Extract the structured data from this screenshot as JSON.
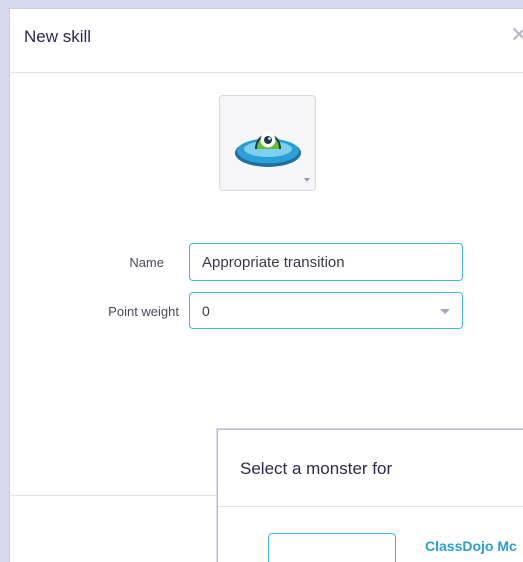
{
  "modal": {
    "title": "New skill",
    "close_glyph": "✕"
  },
  "avatar": {
    "icon": "monster-avatar-icon",
    "colors": {
      "ring": "#2aa0d8",
      "body": "#6cbd3c",
      "eye": "#ffffff"
    }
  },
  "form": {
    "name_label": "Name",
    "name_value": "Appropriate transition",
    "weight_label": "Point weight",
    "weight_value": "0"
  },
  "monster_picker": {
    "title": "Select a monster for",
    "set_link": "ClassDojo Mc"
  },
  "colors": {
    "accent": "#46b3d8",
    "link": "#2a9fd0",
    "text_dark": "#2c2a50"
  }
}
